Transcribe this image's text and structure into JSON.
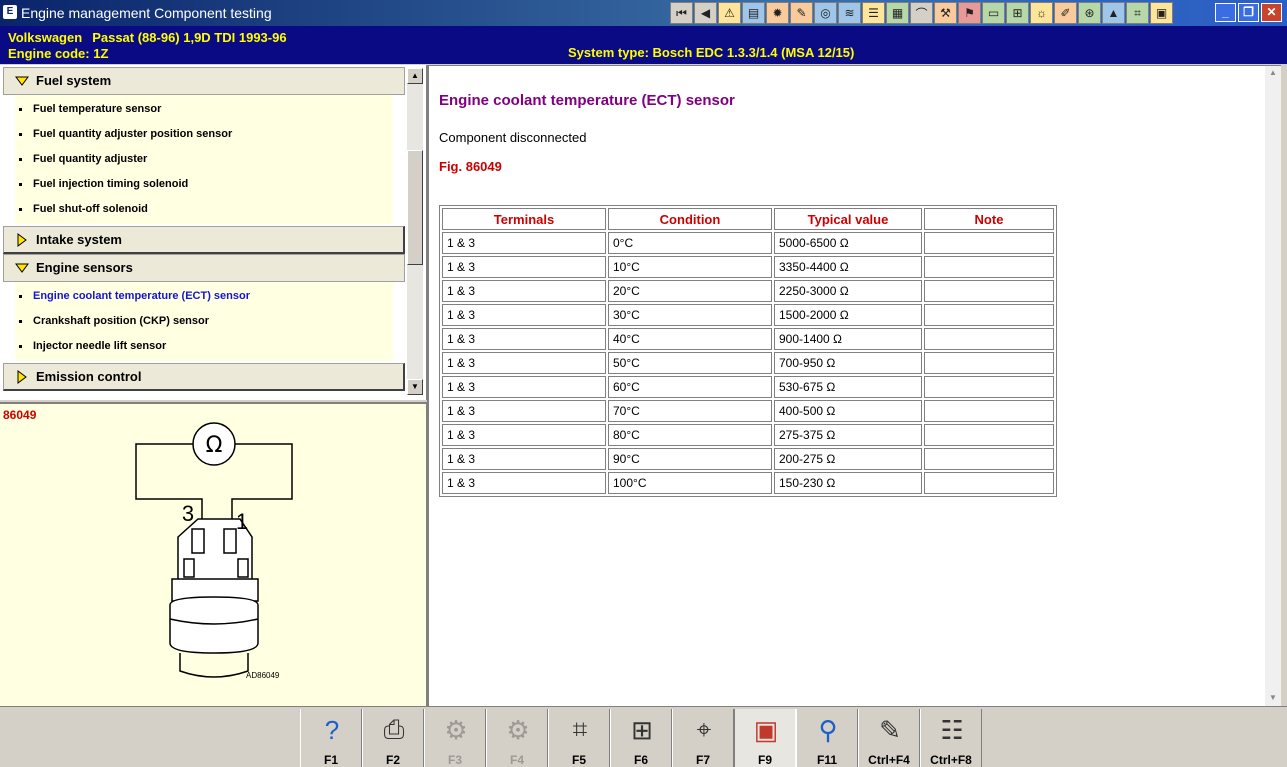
{
  "window": {
    "title": "Engine management Component testing",
    "app_icon": "E",
    "controls": [
      "_",
      "❐",
      "✕"
    ]
  },
  "toolbar": {
    "icons": [
      {
        "name": "first-page-icon",
        "glyph": "⏮"
      },
      {
        "name": "previous-icon",
        "glyph": "◀"
      },
      {
        "name": "warning-icon",
        "glyph": "⚠"
      },
      {
        "name": "picture-icon",
        "glyph": "▤"
      },
      {
        "name": "settings-icon",
        "glyph": "✹"
      },
      {
        "name": "tools-icon",
        "glyph": "✎"
      },
      {
        "name": "gauge-icon",
        "glyph": "◎"
      },
      {
        "name": "wiring-icon",
        "glyph": "≋"
      },
      {
        "name": "list-icon",
        "glyph": "☰"
      },
      {
        "name": "fuse-icon",
        "glyph": "▦"
      },
      {
        "name": "lamp-icon",
        "glyph": "⌒"
      },
      {
        "name": "wrench-icon",
        "glyph": "⚒"
      },
      {
        "name": "fault-codes-icon",
        "glyph": "⚑"
      },
      {
        "name": "battery-icon",
        "glyph": "▭"
      },
      {
        "name": "connector-icon",
        "glyph": "⊞"
      },
      {
        "name": "service-light-icon",
        "glyph": "☼"
      },
      {
        "name": "pen-icon",
        "glyph": "✐"
      },
      {
        "name": "timing-icon",
        "glyph": "⊛"
      },
      {
        "name": "tyre-icon",
        "glyph": "▲"
      },
      {
        "name": "chip-icon",
        "glyph": "⌗"
      },
      {
        "name": "document-icon",
        "glyph": "▣"
      }
    ]
  },
  "vehicle": {
    "make": "Volkswagen",
    "model": "Passat (88-96) 1,9D TDI 1993-96",
    "engine_code": "Engine code: 1Z",
    "system_type": "System type: Bosch EDC 1.3.3/1.4 (MSA 12/15)"
  },
  "nav": {
    "groups": [
      {
        "label": "Fuel system",
        "expanded": true,
        "items": [
          {
            "label": "Fuel temperature sensor",
            "active": false
          },
          {
            "label": "Fuel quantity adjuster position sensor",
            "active": false
          },
          {
            "label": "Fuel quantity adjuster",
            "active": false
          },
          {
            "label": "Fuel injection timing solenoid",
            "active": false
          },
          {
            "label": "Fuel shut-off solenoid",
            "active": false
          }
        ]
      },
      {
        "label": "Intake system",
        "expanded": false,
        "items": []
      },
      {
        "label": "Engine sensors",
        "expanded": true,
        "items": [
          {
            "label": "Engine coolant temperature (ECT) sensor",
            "active": true
          },
          {
            "label": "Crankshaft position (CKP) sensor",
            "active": false
          },
          {
            "label": "Injector needle lift sensor",
            "active": false
          }
        ]
      },
      {
        "label": "Emission control",
        "expanded": false,
        "items": []
      }
    ]
  },
  "figure": {
    "number": "86049",
    "caption": "AD86049",
    "ohm_symbol": "Ω",
    "pin_left": "3",
    "pin_right": "1"
  },
  "content": {
    "heading": "Engine coolant temperature (ECT) sensor",
    "status": "Component disconnected",
    "figure_ref": "Fig. 86049",
    "table": {
      "headers": [
        "Terminals",
        "Condition",
        "Typical value",
        "Note"
      ],
      "rows": [
        [
          "1 & 3",
          "0°C",
          "5000-6500 Ω",
          ""
        ],
        [
          "1 & 3",
          "10°C",
          "3350-4400 Ω",
          ""
        ],
        [
          "1 & 3",
          "20°C",
          "2250-3000 Ω",
          ""
        ],
        [
          "1 & 3",
          "30°C",
          "1500-2000 Ω",
          ""
        ],
        [
          "1 & 3",
          "40°C",
          "900-1400 Ω",
          ""
        ],
        [
          "1 & 3",
          "50°C",
          "700-950 Ω",
          ""
        ],
        [
          "1 & 3",
          "60°C",
          "530-675 Ω",
          ""
        ],
        [
          "1 & 3",
          "70°C",
          "400-500 Ω",
          ""
        ],
        [
          "1 & 3",
          "80°C",
          "275-375 Ω",
          ""
        ],
        [
          "1 & 3",
          "90°C",
          "200-275 Ω",
          ""
        ],
        [
          "1 & 3",
          "100°C",
          "150-230 Ω",
          ""
        ]
      ]
    }
  },
  "fkeys": [
    {
      "label": "F1",
      "icon": "help-icon",
      "glyph": "?",
      "enabled": true,
      "pressed": false,
      "color": "#1c5fc8"
    },
    {
      "label": "F2",
      "icon": "print-icon",
      "glyph": "⎙",
      "enabled": true,
      "pressed": false,
      "color": "#333333"
    },
    {
      "label": "F3",
      "icon": "component-icon",
      "glyph": "⚙",
      "enabled": false,
      "pressed": false,
      "color": "#9c9a94"
    },
    {
      "label": "F4",
      "icon": "component-test-icon",
      "glyph": "⚙",
      "enabled": false,
      "pressed": false,
      "color": "#9c9a94"
    },
    {
      "label": "F5",
      "icon": "wiring-diagram-icon",
      "glyph": "⌗",
      "enabled": true,
      "pressed": false,
      "color": "#333333"
    },
    {
      "label": "F6",
      "icon": "connector-pins-icon",
      "glyph": "⊞",
      "enabled": true,
      "pressed": false,
      "color": "#333333"
    },
    {
      "label": "F7",
      "icon": "locate-icon",
      "glyph": "⌖",
      "enabled": true,
      "pressed": false,
      "color": "#333333"
    },
    {
      "label": "F9",
      "icon": "fault-code-icon",
      "glyph": "▣",
      "enabled": true,
      "pressed": true,
      "color": "#c0392b"
    },
    {
      "label": "F11",
      "icon": "search-component-icon",
      "glyph": "⚲",
      "enabled": true,
      "pressed": false,
      "color": "#1c5fc8"
    },
    {
      "label": "Ctrl+F4",
      "icon": "notes-icon",
      "glyph": "✎",
      "enabled": true,
      "pressed": false,
      "color": "#333333"
    },
    {
      "label": "Ctrl+F8",
      "icon": "table-icon",
      "glyph": "☷",
      "enabled": true,
      "pressed": false,
      "color": "#333333"
    }
  ],
  "colors": {
    "infobar_bg": "#0a0a84",
    "infobar_text": "#ffff00",
    "heading": "#800080",
    "accent_red": "#cc0000",
    "active_link": "#1515d0",
    "nav_items_bg": "#ffffe1"
  }
}
